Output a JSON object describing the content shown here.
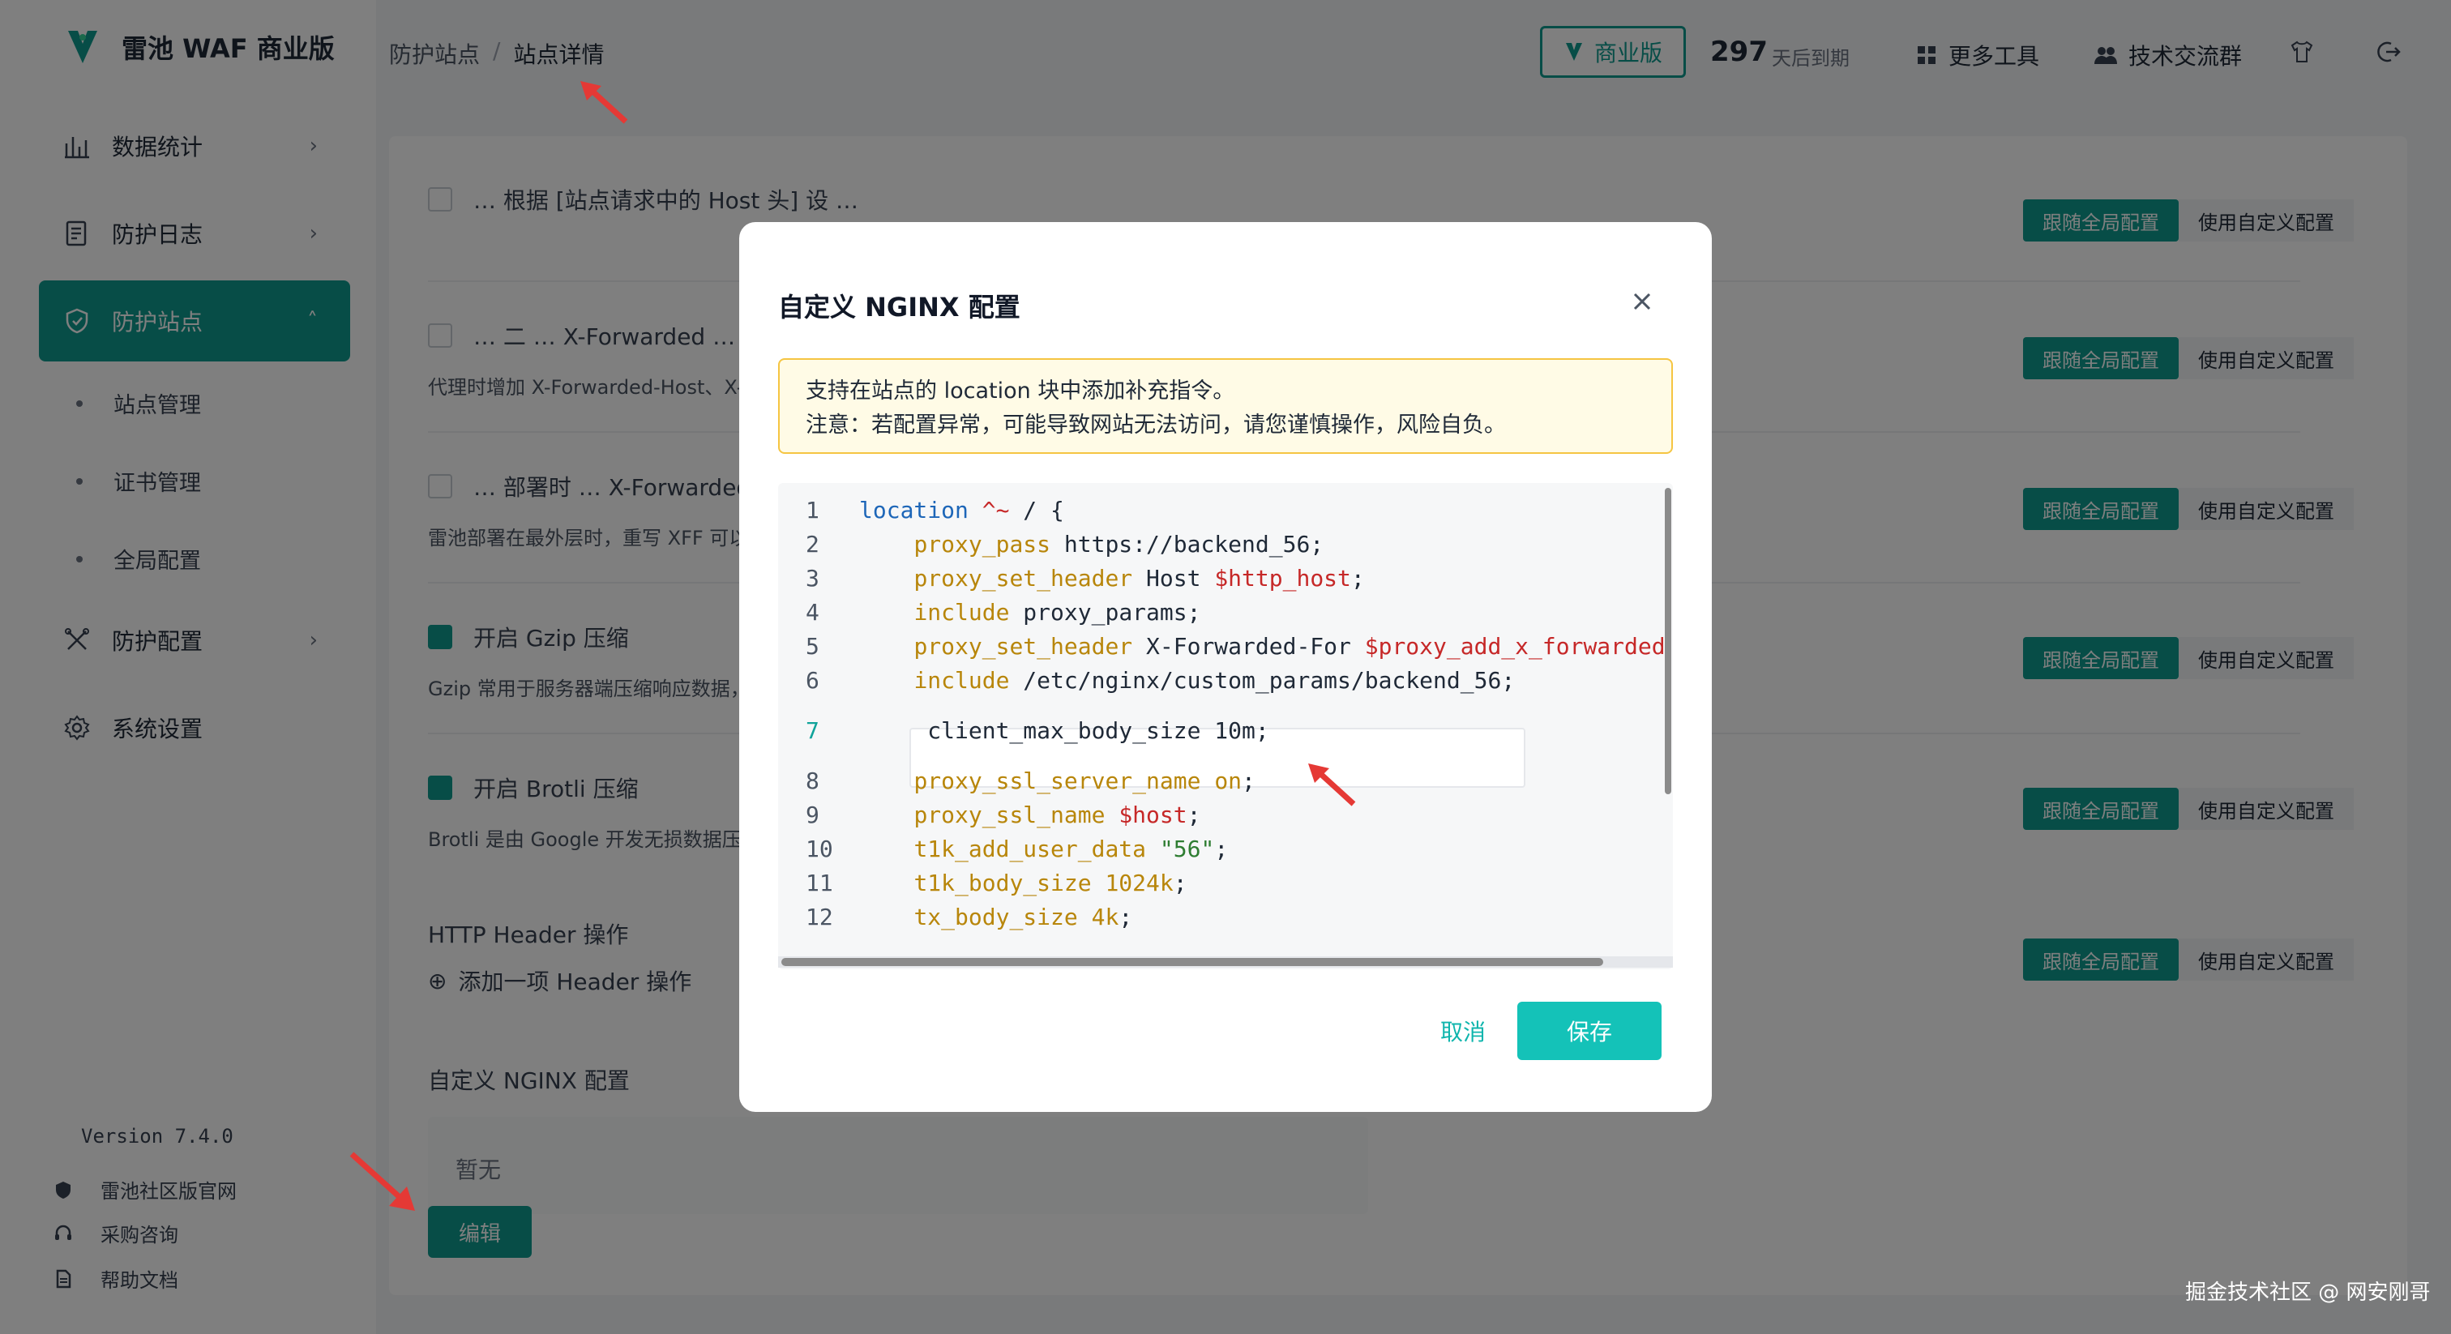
{
  "app": {
    "title": "雷池 WAF 商业版"
  },
  "sidebar": {
    "items": [
      {
        "label": "数据统计",
        "icon": "bar-chart-icon"
      },
      {
        "label": "防护日志",
        "icon": "log-icon"
      },
      {
        "label": "防护站点",
        "icon": "shield-icon"
      },
      {
        "label": "防护配置",
        "icon": "tools-icon"
      },
      {
        "label": "系统设置",
        "icon": "gear-icon"
      }
    ],
    "sub_items": [
      "站点管理",
      "证书管理",
      "全局配置"
    ],
    "version": "Version 7.4.0",
    "footer_links": [
      "雷池社区版官网",
      "采购咨询",
      "帮助文档"
    ]
  },
  "breadcrumb": {
    "parent": "防护站点",
    "separator": "/",
    "current": "站点详情"
  },
  "topbar": {
    "edition": "商业版",
    "days_number": "297",
    "days_text": "天后到期",
    "more_tools": "更多工具",
    "tech_group": "技术交流群"
  },
  "main": {
    "rows": [
      {
        "title": "… 根据 [站点请求中的 Host 头] 设 …",
        "desc": "",
        "checked": false
      },
      {
        "title": "… 二 … X-Forwarded …",
        "desc": "代理时增加 X-Forwarded-Host、X-",
        "checked": false
      },
      {
        "title": "… 部署时 … X-Forwarded …",
        "desc": "雷池部署在最外层时，重写 XFF 可以",
        "checked": false
      },
      {
        "title": "开启 Gzip 压缩",
        "desc": "Gzip 常用于服务器端压缩响应数据，",
        "checked": true
      },
      {
        "title": "开启 Brotli 压缩",
        "desc": "Brotli 是由 Google 开发无损数据压",
        "checked": true
      }
    ],
    "follow_global": "跟随全局配置",
    "use_custom": "使用自定义配置",
    "http_header_title": "HTTP Header 操作",
    "add_header": "添加一项 Header 操作",
    "nginx_title": "自定义 NGINX 配置",
    "empty_text": "暂无",
    "edit_button": "编辑"
  },
  "modal": {
    "title": "自定义 NGINX 配置",
    "alert_line1": "支持在站点的 location 块中添加补充指令。",
    "alert_line2": "注意：若配置异常，可能导致网站无法访问，请您谨慎操作，风险自负。",
    "code_lines": [
      {
        "n": "1",
        "parts": [
          [
            "kw-blue",
            "location"
          ],
          [
            "plain",
            " "
          ],
          [
            "kw-red",
            "^~"
          ],
          [
            "plain",
            " / {"
          ]
        ]
      },
      {
        "n": "2",
        "parts": [
          [
            "plain",
            "    "
          ],
          [
            "kw-orange",
            "proxy_pass"
          ],
          [
            "plain",
            " https://backend_56;"
          ]
        ]
      },
      {
        "n": "3",
        "parts": [
          [
            "plain",
            "    "
          ],
          [
            "kw-orange",
            "proxy_set_header"
          ],
          [
            "plain",
            " Host "
          ],
          [
            "kw-red",
            "$http_host"
          ],
          [
            "plain",
            ";"
          ]
        ]
      },
      {
        "n": "4",
        "parts": [
          [
            "plain",
            "    "
          ],
          [
            "kw-orange",
            "include"
          ],
          [
            "plain",
            " proxy_params;"
          ]
        ]
      },
      {
        "n": "5",
        "parts": [
          [
            "plain",
            "    "
          ],
          [
            "kw-orange",
            "proxy_set_header"
          ],
          [
            "plain",
            " X-Forwarded-For "
          ],
          [
            "kw-red",
            "$proxy_add_x_forwarded"
          ]
        ]
      },
      {
        "n": "6",
        "parts": [
          [
            "plain",
            "    "
          ],
          [
            "kw-orange",
            "include"
          ],
          [
            "plain",
            " /etc/nginx/custom_params/backend_56;"
          ]
        ]
      },
      {
        "n": "7",
        "parts": [
          [
            "plain",
            "     client_max_body_size 10m;"
          ]
        ],
        "highlight": true
      },
      {
        "n": "8",
        "parts": [
          [
            "plain",
            "    "
          ],
          [
            "kw-orange",
            "proxy_ssl_server_name"
          ],
          [
            "plain",
            " "
          ],
          [
            "kw-orange",
            "on"
          ],
          [
            "plain",
            ";"
          ]
        ]
      },
      {
        "n": "9",
        "parts": [
          [
            "plain",
            "    "
          ],
          [
            "kw-orange",
            "proxy_ssl_name"
          ],
          [
            "plain",
            " "
          ],
          [
            "kw-red",
            "$host"
          ],
          [
            "plain",
            ";"
          ]
        ]
      },
      {
        "n": "10",
        "parts": [
          [
            "plain",
            "    "
          ],
          [
            "kw-orange",
            "t1k_add_user_data"
          ],
          [
            "plain",
            " "
          ],
          [
            "str-green",
            "\"56\""
          ],
          [
            "plain",
            ";"
          ]
        ]
      },
      {
        "n": "11",
        "parts": [
          [
            "plain",
            "    "
          ],
          [
            "kw-orange",
            "t1k_body_size"
          ],
          [
            "plain",
            " "
          ],
          [
            "kw-orange",
            "1024k"
          ],
          [
            "plain",
            ";"
          ]
        ]
      },
      {
        "n": "12",
        "parts": [
          [
            "plain",
            "    "
          ],
          [
            "kw-orange",
            "tx_body_size"
          ],
          [
            "plain",
            " "
          ],
          [
            "kw-orange",
            "4k"
          ],
          [
            "plain",
            ";"
          ]
        ]
      }
    ],
    "cancel": "取消",
    "save": "保存"
  },
  "watermark": "掘金技术社区 @ 网安刚哥",
  "colors": {
    "accent": "#0f9b8e",
    "save": "#14c2b8",
    "alert_bg": "#fffbe6",
    "alert_border": "#f5c542",
    "arrow": "#e53935"
  }
}
